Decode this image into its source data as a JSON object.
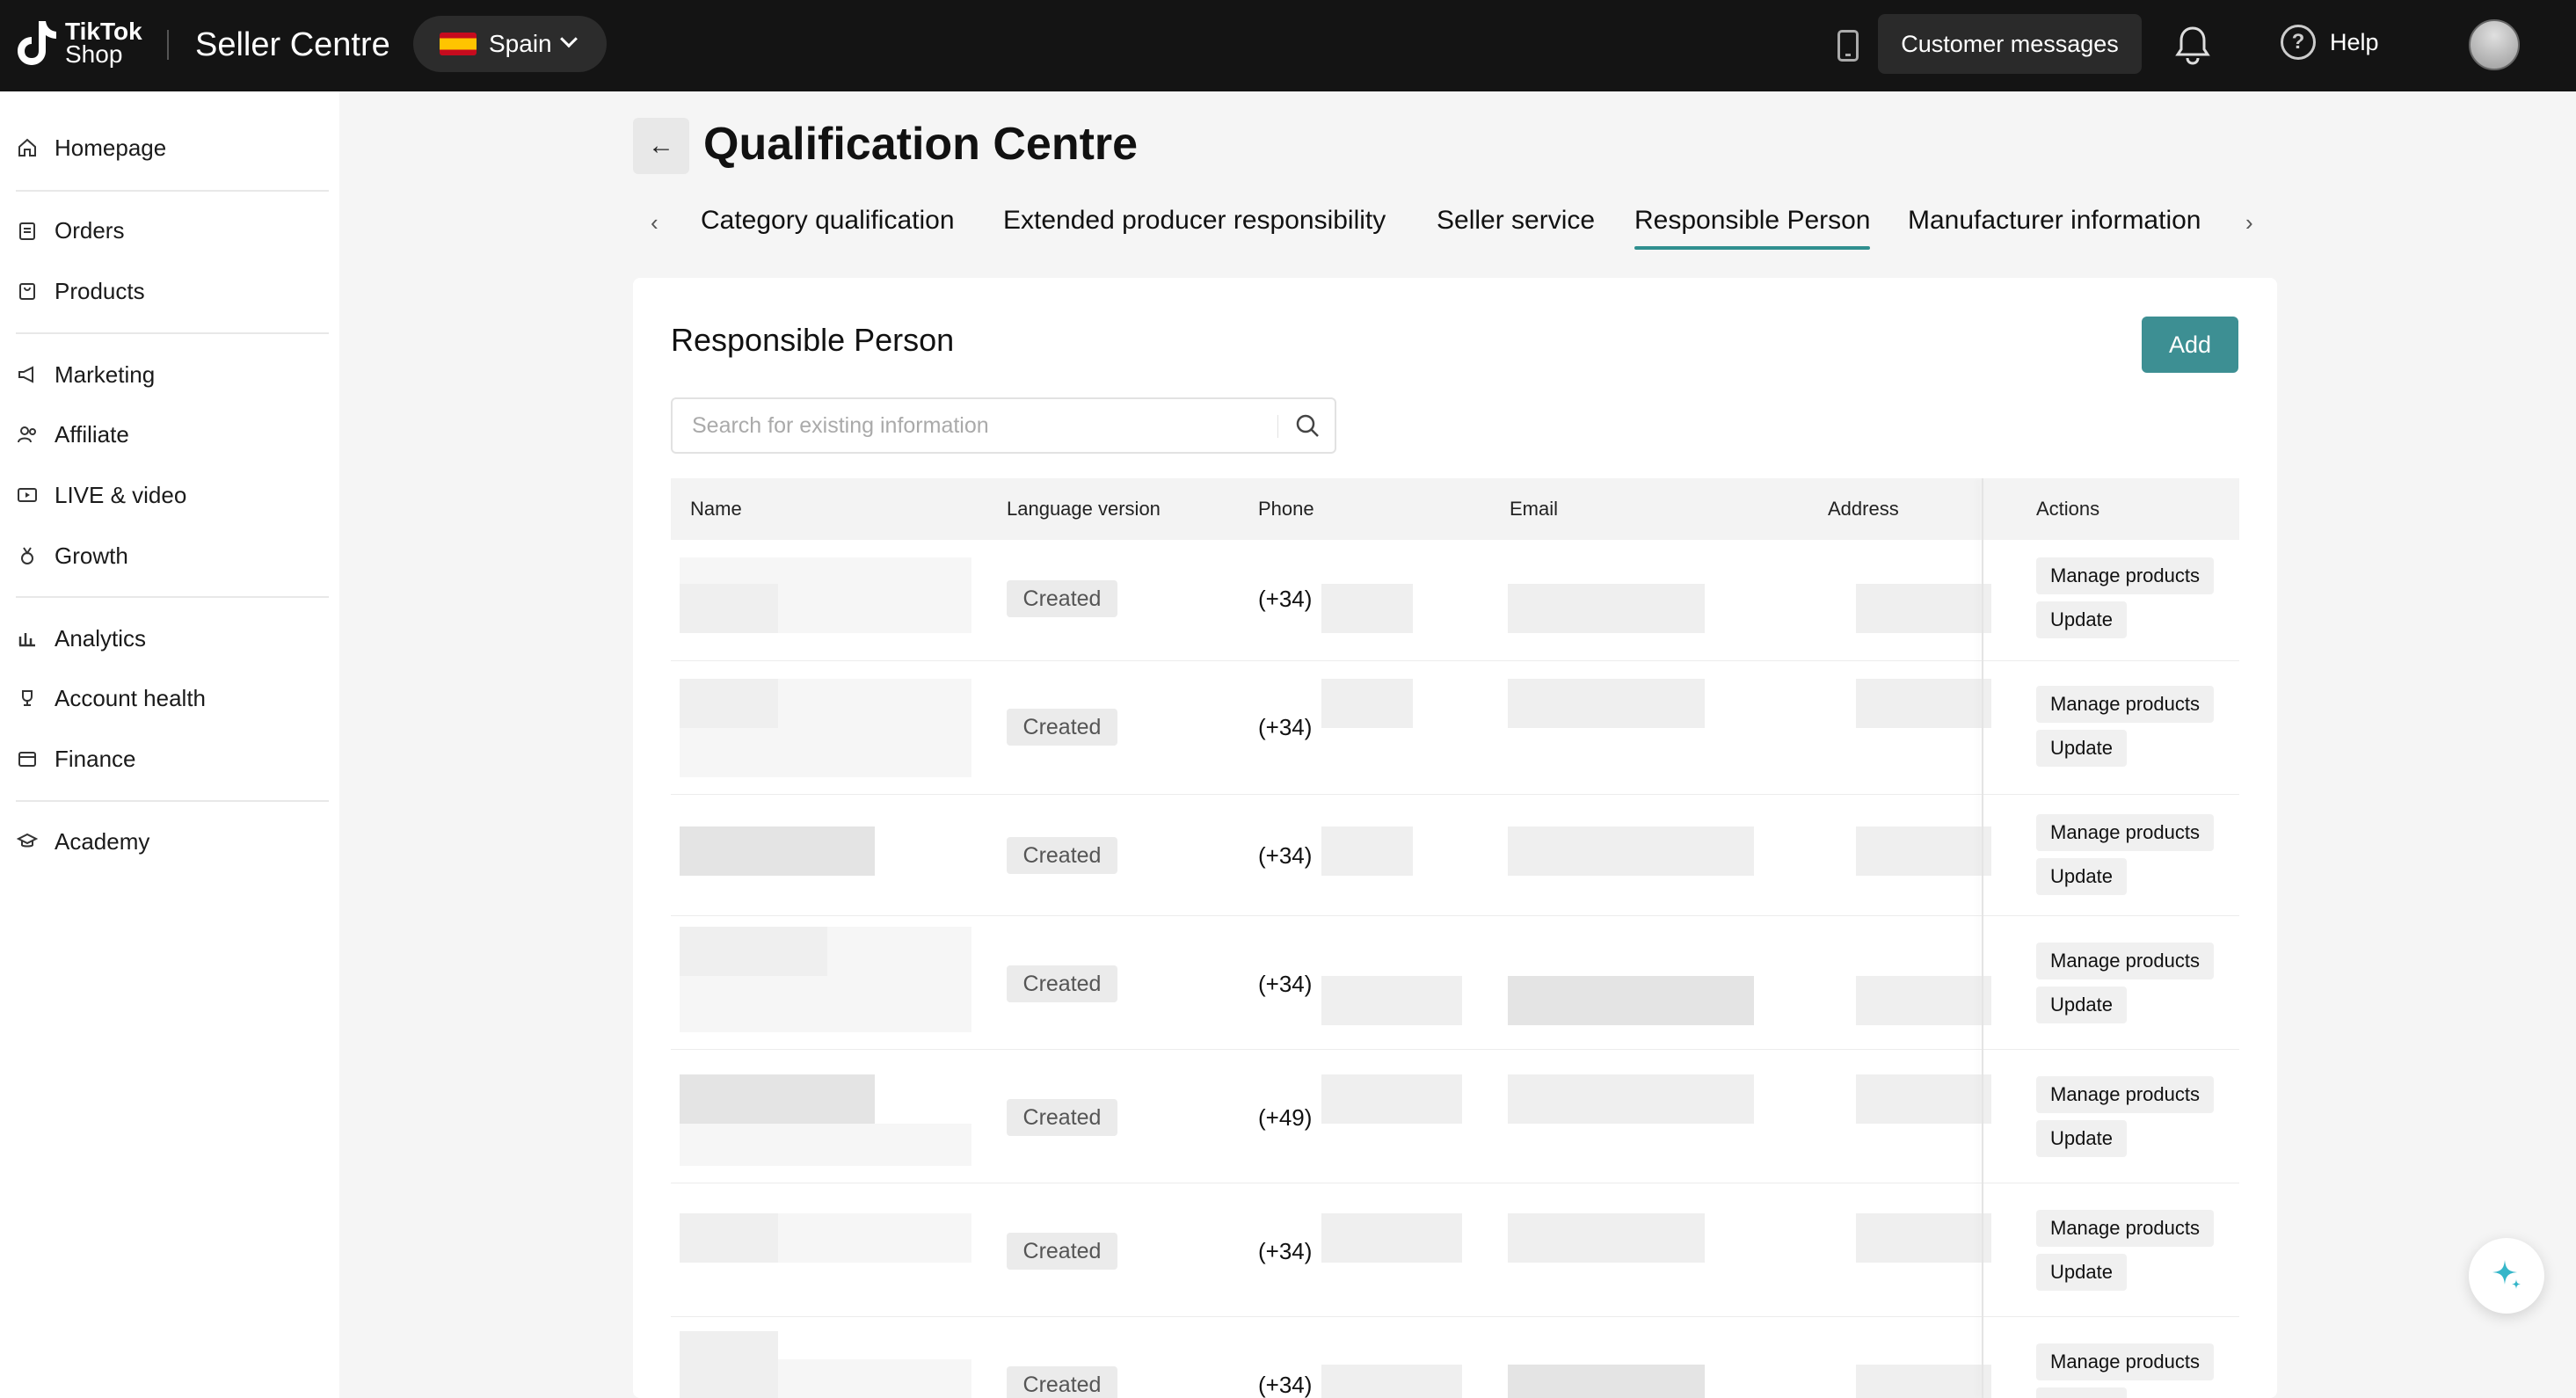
{
  "topbar": {
    "logo_line1": "TikTok",
    "logo_line2": "Shop",
    "brand_title": "Seller Centre",
    "country": "Spain",
    "customer_messages": "Customer messages",
    "help": "Help"
  },
  "sidebar": {
    "items": [
      {
        "label": "Homepage",
        "icon": "home-icon"
      },
      {
        "label": "Orders",
        "icon": "clipboard-icon"
      },
      {
        "label": "Products",
        "icon": "bag-icon"
      },
      {
        "label": "Marketing",
        "icon": "megaphone-icon"
      },
      {
        "label": "Affiliate",
        "icon": "people-icon"
      },
      {
        "label": "LIVE & video",
        "icon": "video-icon"
      },
      {
        "label": "Growth",
        "icon": "medal-icon"
      },
      {
        "label": "Analytics",
        "icon": "chart-icon"
      },
      {
        "label": "Account health",
        "icon": "trophy-icon"
      },
      {
        "label": "Finance",
        "icon": "wallet-icon"
      },
      {
        "label": "Academy",
        "icon": "graduation-cap-icon"
      }
    ]
  },
  "page": {
    "title": "Qualification Centre",
    "tabs": [
      {
        "label": "Category qualification"
      },
      {
        "label": "Extended producer responsibility"
      },
      {
        "label": "Seller service"
      },
      {
        "label": "Responsible Person",
        "active": true
      },
      {
        "label": "Manufacturer information"
      }
    ]
  },
  "card": {
    "title": "Responsible Person",
    "add_label": "Add",
    "search_placeholder": "Search for existing information"
  },
  "table": {
    "columns": [
      "Name",
      "Language version",
      "Phone",
      "Email",
      "Address",
      "Actions"
    ],
    "rows": [
      {
        "status": "Created",
        "phone": "(+34)",
        "actions": [
          "Manage products",
          "Update"
        ]
      },
      {
        "status": "Created",
        "phone": "(+34)",
        "actions": [
          "Manage products",
          "Update"
        ]
      },
      {
        "status": "Created",
        "phone": "(+34)",
        "actions": [
          "Manage products",
          "Update"
        ]
      },
      {
        "status": "Created",
        "phone": "(+34)",
        "actions": [
          "Manage products",
          "Update"
        ]
      },
      {
        "status": "Created",
        "phone": "(+49)",
        "actions": [
          "Manage products",
          "Update"
        ]
      },
      {
        "status": "Created",
        "phone": "(+34)",
        "actions": [
          "Manage products",
          "Update"
        ]
      },
      {
        "status": "Created",
        "phone": "(+34)",
        "actions": [
          "Manage products",
          "Update"
        ]
      }
    ]
  },
  "colors": {
    "accent": "#3d8f93",
    "topbar": "#141414",
    "tab_underline": "#2f8f8f"
  }
}
